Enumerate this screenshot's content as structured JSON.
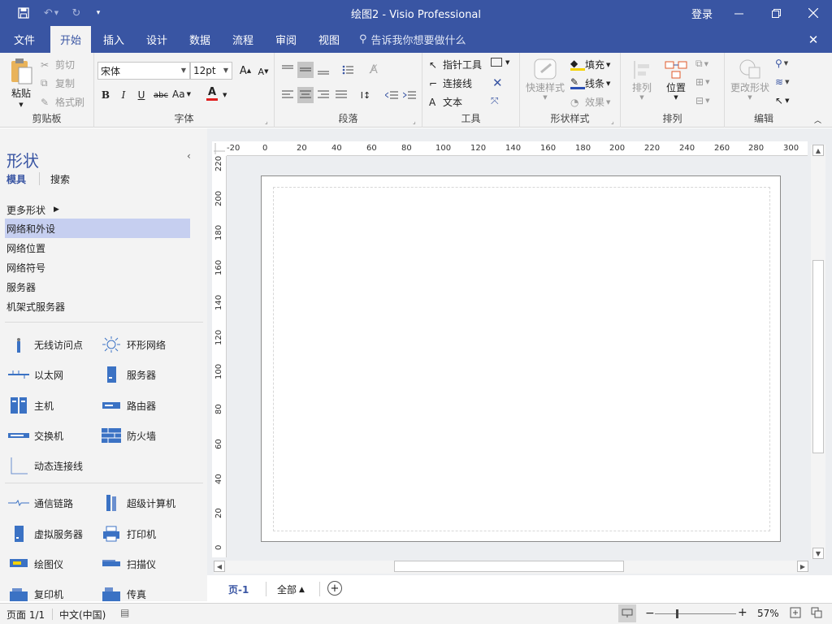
{
  "title": "绘图2 - Visio Professional",
  "login": "登录",
  "tabs": [
    {
      "label": "文件"
    },
    {
      "label": "开始"
    },
    {
      "label": "插入"
    },
    {
      "label": "设计"
    },
    {
      "label": "数据"
    },
    {
      "label": "流程"
    },
    {
      "label": "审阅"
    },
    {
      "label": "视图"
    }
  ],
  "tell_me": "告诉我你想要做什么",
  "clipboard": {
    "paste": "粘贴",
    "cut": "剪切",
    "copy": "复制",
    "format_painter": "格式刷",
    "label": "剪贴板"
  },
  "font": {
    "name": "宋体",
    "size": "12pt",
    "label": "字体",
    "bold": "B",
    "italic": "I",
    "underline": "U",
    "strike": "abc",
    "case": "Aa",
    "color": "A"
  },
  "paragraph": {
    "label": "段落"
  },
  "tools": {
    "pointer": "指针工具",
    "connector": "连接线",
    "text": "文本",
    "label": "工具"
  },
  "shape_style": {
    "quick": "快速样式",
    "fill": "填充",
    "line": "线条",
    "effect": "效果",
    "label": "形状样式"
  },
  "arrange": {
    "arrange": "排列",
    "position": "位置",
    "label": "排列"
  },
  "edit": {
    "change_shape": "更改形状",
    "label": "编辑"
  },
  "panel": {
    "title": "形状",
    "tab_stencil": "模具",
    "tab_search": "搜索",
    "more": "更多形状",
    "categories": [
      "网络和外设",
      "网络位置",
      "网络符号",
      "服务器",
      "机架式服务器"
    ],
    "shapes": [
      "无线访问点",
      "环形网络",
      "以太网",
      "服务器",
      "主机",
      "路由器",
      "交换机",
      "防火墙",
      "动态连接线",
      "通信链路",
      "超级计算机",
      "虚拟服务器",
      "打印机",
      "绘图仪",
      "扫描仪",
      "复印机",
      "传真"
    ]
  },
  "ruler": {
    "h": [
      "-20",
      "0",
      "20",
      "40",
      "60",
      "80",
      "100",
      "120",
      "140",
      "160",
      "180",
      "200",
      "220",
      "240",
      "260",
      "280",
      "300"
    ],
    "v": [
      "220",
      "200",
      "180",
      "160",
      "140",
      "120",
      "100",
      "80",
      "60",
      "40",
      "20",
      "0"
    ]
  },
  "page_tabs": {
    "page1": "页-1",
    "all": "全部"
  },
  "status": {
    "page": "页面 1/1",
    "lang": "中文(中国)",
    "zoom": "57%"
  }
}
